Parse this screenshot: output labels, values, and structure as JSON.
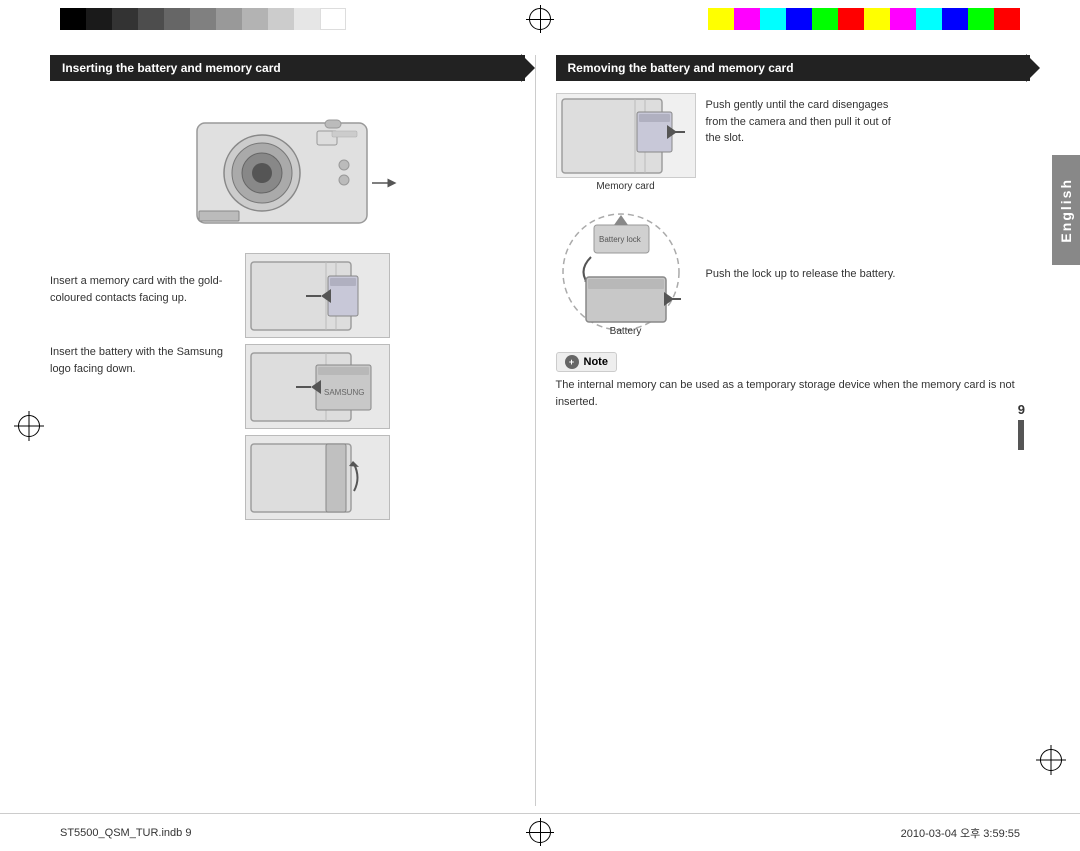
{
  "colors": {
    "black_strip": [
      "#000000",
      "#1a1a1a",
      "#333333",
      "#4d4d4d",
      "#666666",
      "#808080",
      "#999999",
      "#b3b3b3",
      "#cccccc",
      "#e6e6e6",
      "#ffffff"
    ],
    "color_strip": [
      "#ffff00",
      "#ff00ff",
      "#00ffff",
      "#0000ff",
      "#00ff00",
      "#ff0000"
    ],
    "dark_bar": "#222222",
    "gray_tab": "#888888"
  },
  "left_section": {
    "header": "Inserting the battery and memory card",
    "instruction1": {
      "text": "Insert a memory card with the gold-coloured contacts facing up."
    },
    "instruction2": {
      "text": "Insert the battery with the Samsung logo facing down."
    }
  },
  "right_section": {
    "header": "Removing the battery and memory card",
    "memory_card_label": "Memory card",
    "memory_card_desc": "Push gently until the card disengages from the camera and then pull it out of the slot.",
    "battery_lock_label": "Battery lock",
    "battery_label": "Battery",
    "battery_desc": "Push the lock up to release the battery.",
    "note_label": "Note",
    "note_text": "The internal memory can be used as a temporary storage device when the memory card is not inserted."
  },
  "footer": {
    "left": "ST5500_QSM_TUR.indb   9",
    "right": "2010-03-04   오후 3:59:55",
    "page_number": "9"
  },
  "english_tab": "English"
}
